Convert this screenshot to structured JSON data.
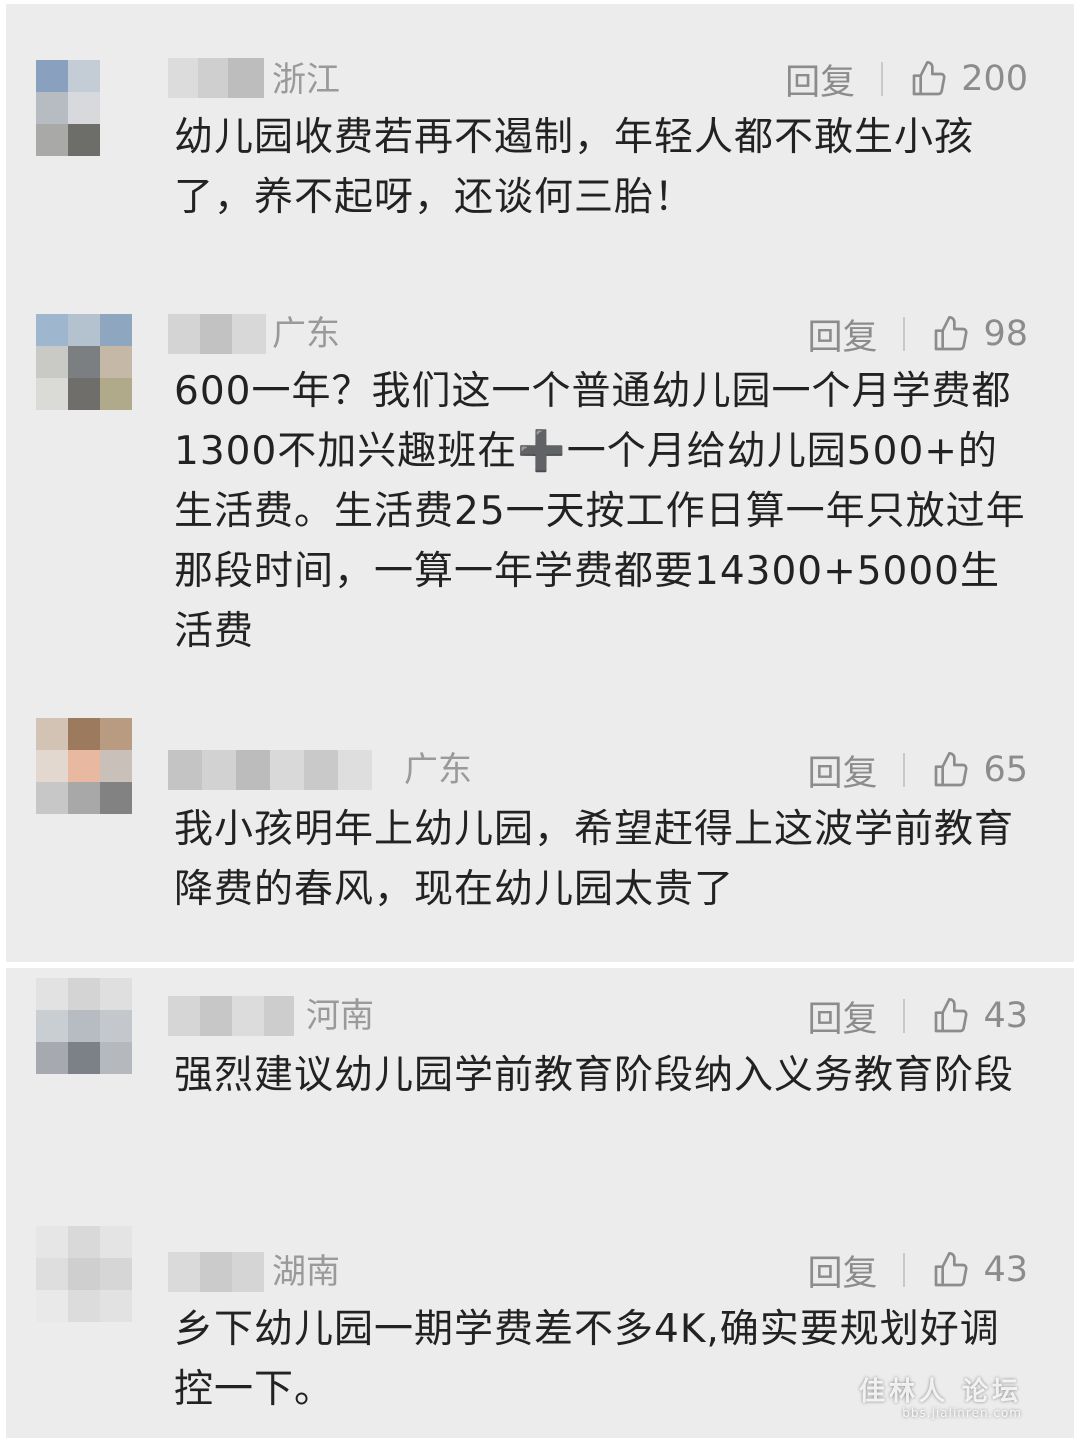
{
  "colors": {
    "panel_bg": "#ececec",
    "meta_text": "#9a9a9a",
    "action_text": "#8c8c8c",
    "body_text": "#222222"
  },
  "icons": {
    "like": "thumbs-up-icon"
  },
  "comments": [
    {
      "region": "浙江",
      "reply": "回复",
      "likes": "200",
      "text": "幼儿园收费若再不遏制，年轻人都不敢生小孩了，养不起呀，还谈何三胎！"
    },
    {
      "region": "广东",
      "reply": "回复",
      "likes": "98",
      "text": "600一年？我们这一个普通幼儿园一个月学费都1300不加兴趣班在➕一个月给幼儿园500+的生活费。生活费25一天按工作日算一年只放过年那段时间，一算一年学费都要14300+5000生活费"
    },
    {
      "region": "广东",
      "reply": "回复",
      "likes": "65",
      "text": "我小孩明年上幼儿园，希望赶得上这波学前教育降费的春风，现在幼儿园太贵了"
    },
    {
      "region": "河南",
      "reply": "回复",
      "likes": "43",
      "text": "强烈建议幼儿园学前教育阶段纳入义务教育阶段"
    },
    {
      "region": "湖南",
      "reply": "回复",
      "likes": "43",
      "text": "乡下幼儿园一期学费差不多4K,确实要规划好调控一下。"
    }
  ],
  "watermark": {
    "main": "佳林人 论坛",
    "sub": "bbs.jialinren.com"
  }
}
